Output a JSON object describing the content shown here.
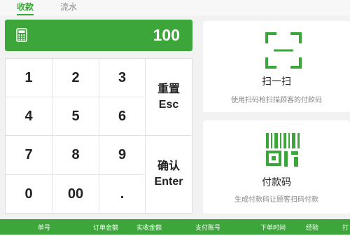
{
  "tabs": [
    {
      "label": "收款",
      "active": true
    },
    {
      "label": "流水",
      "active": false
    }
  ],
  "display": {
    "icon": "calculator-icon",
    "value": "100"
  },
  "keypad": {
    "digits": [
      "1",
      "2",
      "3",
      "4",
      "5",
      "6",
      "7",
      "8",
      "9",
      "0",
      "00",
      "."
    ],
    "reset": {
      "label": "重置",
      "key": "Esc"
    },
    "confirm": {
      "label": "确认",
      "key": "Enter"
    }
  },
  "scan_card": {
    "icon": "scan-icon",
    "title": "扫一扫",
    "subtitle": "使用扫码枪扫描顾客的付款码"
  },
  "pay_code_card": {
    "icon": "barcode-icon",
    "title": "付款码",
    "subtitle": "生成付款码让顾客扫码付款"
  },
  "table": {
    "columns": [
      "单号",
      "订单金额",
      "实收金额",
      "支付账号",
      "下单时间",
      "经验",
      "打"
    ]
  },
  "colors": {
    "accent": "#3ca63a",
    "background": "#f2f2f2"
  }
}
